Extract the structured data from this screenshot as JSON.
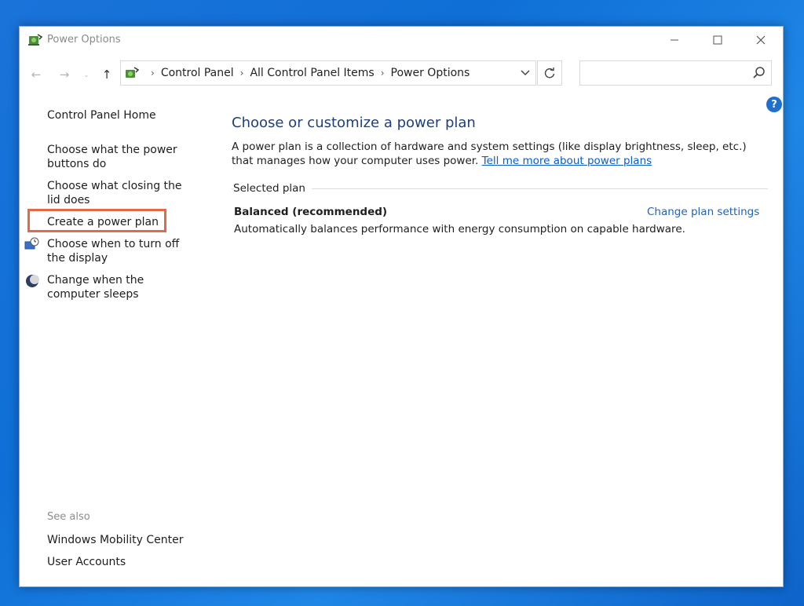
{
  "window": {
    "title": "Power Options"
  },
  "navigation": {
    "back_glyph": "←",
    "forward_glyph": "→",
    "recent_glyph": "⌄",
    "up_glyph": "↑"
  },
  "address_bar": {
    "crumbs": [
      "Control Panel",
      "All Control Panel Items",
      "Power Options"
    ],
    "separator": "›"
  },
  "search": {
    "placeholder": ""
  },
  "help": {
    "label": "?"
  },
  "left_pane": {
    "home": "Control Panel Home",
    "links": [
      "Choose what the power buttons do",
      "Choose what closing the lid does",
      "Create a power plan",
      "Choose when to turn off the display",
      "Change when the computer sleeps"
    ],
    "highlighted_index": 2,
    "see_also_label": "See also",
    "see_also": [
      "Windows Mobility Center",
      "User Accounts"
    ]
  },
  "main": {
    "title": "Choose or customize a power plan",
    "description": "A power plan is a collection of hardware and system settings (like display brightness, sleep, etc.) that manages how your computer uses power.",
    "description_link": "Tell me more about power plans",
    "group_label": "Selected plan",
    "plan": {
      "name": "Balanced (recommended)",
      "description": "Automatically balances performance with energy consumption on capable hardware.",
      "change_link": "Change plan settings"
    }
  },
  "colors": {
    "accent": "#1a63c7",
    "title_blue": "#1e3f78",
    "highlight_box": "#e06a4a",
    "desktop": "#1a73d9"
  }
}
